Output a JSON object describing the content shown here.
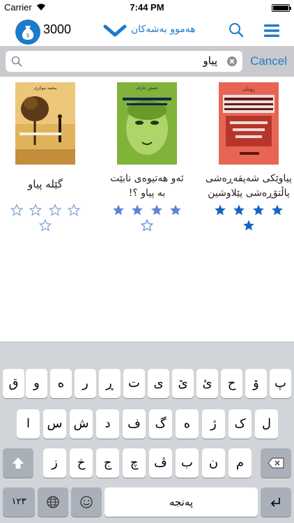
{
  "status_bar": {
    "carrier": "Carrier",
    "time": "7:44 PM"
  },
  "nav": {
    "coins": "3000",
    "title": "هەموو بەشەکان"
  },
  "search": {
    "query": "پیاو",
    "cancel_label": "Cancel"
  },
  "books": [
    {
      "title": "پیاوێکی شەپقەڕەشی\nپاڵتۆڕەشی پێلاوشین",
      "rating": 5
    },
    {
      "title": "ئەو هەتیوەی نابێت\nبە پیاو ؟!",
      "rating": 4
    },
    {
      "title": "گێلە پیاو",
      "rating": 0
    }
  ],
  "colors": {
    "accent": "#1e7bc8",
    "star_filled": "#1565c0",
    "star_half": "#5b86d6",
    "star_empty": "#7fa0d6"
  },
  "keyboard": {
    "row1": [
      "پ",
      "ۆ",
      "ح",
      "ئ",
      "ێ",
      "ی",
      "ت",
      "ڕ",
      "ر",
      "ە",
      "و",
      "ق"
    ],
    "row2": [
      "ل",
      "ک",
      "ژ",
      "ه",
      "گ",
      "ف",
      "د",
      "ش",
      "س",
      "ا"
    ],
    "row3": [
      "م",
      "ن",
      "ب",
      "ڤ",
      "چ",
      "ج",
      "خ",
      "ز"
    ],
    "numbers_label": "١٢٣",
    "space_label": "پەنجە"
  }
}
